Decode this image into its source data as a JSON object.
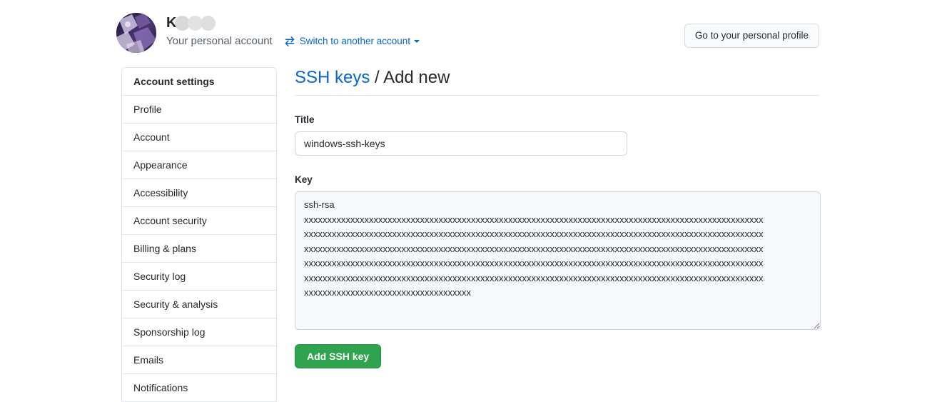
{
  "header": {
    "avatar_name": "user-avatar",
    "account_name_visible": "K",
    "account_subtitle": "Your personal account",
    "switch_account_label": "Switch to another account",
    "switch_icon": "arrow-switch-icon",
    "caret_icon": "chevron-down-icon",
    "profile_button_label": "Go to your personal profile"
  },
  "sidebar": {
    "items": [
      {
        "label": "Account settings",
        "is_header": true
      },
      {
        "label": "Profile",
        "is_header": false
      },
      {
        "label": "Account",
        "is_header": false
      },
      {
        "label": "Appearance",
        "is_header": false
      },
      {
        "label": "Accessibility",
        "is_header": false
      },
      {
        "label": "Account security",
        "is_header": false
      },
      {
        "label": "Billing & plans",
        "is_header": false
      },
      {
        "label": "Security log",
        "is_header": false
      },
      {
        "label": "Security & analysis",
        "is_header": false
      },
      {
        "label": "Sponsorship log",
        "is_header": false
      },
      {
        "label": "Emails",
        "is_header": false
      },
      {
        "label": "Notifications",
        "is_header": false
      }
    ]
  },
  "main": {
    "breadcrumb_link": "SSH keys",
    "breadcrumb_separator": " / ",
    "breadcrumb_current": "Add new",
    "title_label": "Title",
    "title_value": "windows-ssh-keys",
    "title_placeholder": "",
    "key_label": "Key",
    "key_value": "ssh-rsa\nxxxxxxxxxxxxxxxxxxxxxxxxxxxxxxxxxxxxxxxxxxxxxxxxxxxxxxxxxxxxxxxxxxxxxxxxxxxxxxxxxxxxxxxxxxxxxxxxxxx\nxxxxxxxxxxxxxxxxxxxxxxxxxxxxxxxxxxxxxxxxxxxxxxxxxxxxxxxxxxxxxxxxxxxxxxxxxxxxxxxxxxxxxxxxxxxxxxxxxxx\nxxxxxxxxxxxxxxxxxxxxxxxxxxxxxxxxxxxxxxxxxxxxxxxxxxxxxxxxxxxxxxxxxxxxxxxxxxxxxxxxxxxxxxxxxxxxxxxxxxx\nxxxxxxxxxxxxxxxxxxxxxxxxxxxxxxxxxxxxxxxxxxxxxxxxxxxxxxxxxxxxxxxxxxxxxxxxxxxxxxxxxxxxxxxxxxxxxxxxxxx\nxxxxxxxxxxxxxxxxxxxxxxxxxxxxxxxxxxxxxxxxxxxxxxxxxxxxxxxxxxxxxxxxxxxxxxxxxxxxxxxxxxxxxxxxxxxxxxxxxxx\nxxxxxxxxxxxxxxxxxxxxxxxxxxxxxxxxxxxx",
    "key_placeholder": "",
    "submit_label": "Add SSH key"
  },
  "colors": {
    "accent_blue": "#0366d6",
    "success_green": "#2ea44f",
    "border_gray": "#e1e4e8",
    "input_border": "#d1d5da",
    "textarea_bg": "#f6f8fa",
    "text_primary": "#24292e",
    "text_muted": "#586069"
  }
}
